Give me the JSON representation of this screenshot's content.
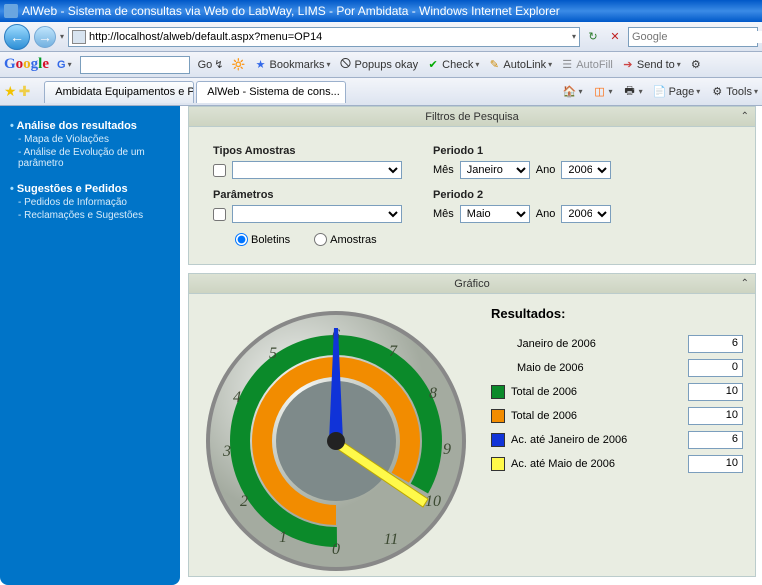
{
  "window": {
    "title": "AlWeb - Sistema de consultas via Web do LabWay, LIMS - Por Ambidata - Windows Internet Explorer"
  },
  "nav": {
    "url": "http://localhost/alweb/default.aspx?menu=OP14",
    "search_placeholder": "Google"
  },
  "gtoolbar": {
    "go": "Go",
    "bookmarks": "Bookmarks",
    "popups": "Popups okay",
    "check": "Check",
    "autolink": "AutoLink",
    "autofill": "AutoFill",
    "sendto": "Send to",
    "settings": "Settings"
  },
  "tabs": [
    {
      "label": "Ambidata Equipamentos e Pr..."
    },
    {
      "label": "AlWeb - Sistema de cons..."
    }
  ],
  "tabbar": {
    "page": "Page",
    "tools": "Tools"
  },
  "sidebar": {
    "section1": {
      "head": "Análise dos resultados",
      "items": [
        "Mapa de Violações",
        "Análise de Evolução de um parâmetro"
      ]
    },
    "section2": {
      "head": "Sugestões e Pedidos",
      "items": [
        "Pedidos de Informação",
        "Reclamações e Sugestões"
      ]
    }
  },
  "filters": {
    "title": "Filtros de Pesquisa",
    "tipos_label": "Tipos Amostras",
    "parametros_label": "Parâmetros",
    "periodo1": "Periodo 1",
    "periodo2": "Periodo 2",
    "mes": "Mês",
    "ano": "Ano",
    "mes1": "Janeiro",
    "ano1": "2006",
    "mes2": "Maio",
    "ano2": "2006",
    "boletins": "Boletins",
    "amostras": "Amostras"
  },
  "chart": {
    "title": "Gráfico",
    "results_title": "Resultados:",
    "rows": [
      {
        "label": "Janeiro de 2006",
        "value": "6",
        "sw": ""
      },
      {
        "label": "Maio de 2006",
        "value": "0",
        "sw": ""
      },
      {
        "label": "Total de 2006",
        "value": "10",
        "sw": "#0b8a2a"
      },
      {
        "label": "Total de 2006",
        "value": "10",
        "sw": "#f28c00"
      },
      {
        "label": "Ac. até Janeiro de 2006",
        "value": "6",
        "sw": "#1033d8"
      },
      {
        "label": "Ac. até Maio de 2006",
        "value": "10",
        "sw": "#fff94a"
      }
    ]
  },
  "chart_data": {
    "type": "gauge",
    "title": "Gráfico",
    "range": [
      0,
      12
    ],
    "ticks": [
      0,
      1,
      2,
      3,
      4,
      5,
      6,
      7,
      8,
      9,
      10,
      11
    ],
    "series": [
      {
        "name": "Total de 2006 (inner)",
        "color": "#0b8a2a",
        "value": 10
      },
      {
        "name": "Total de 2006 (outer)",
        "color": "#f28c00",
        "value": 10
      },
      {
        "name": "Ac. até Janeiro de 2006",
        "color": "#1033d8",
        "value": 6
      },
      {
        "name": "Ac. até Maio de 2006",
        "color": "#fff94a",
        "value": 10
      }
    ]
  }
}
